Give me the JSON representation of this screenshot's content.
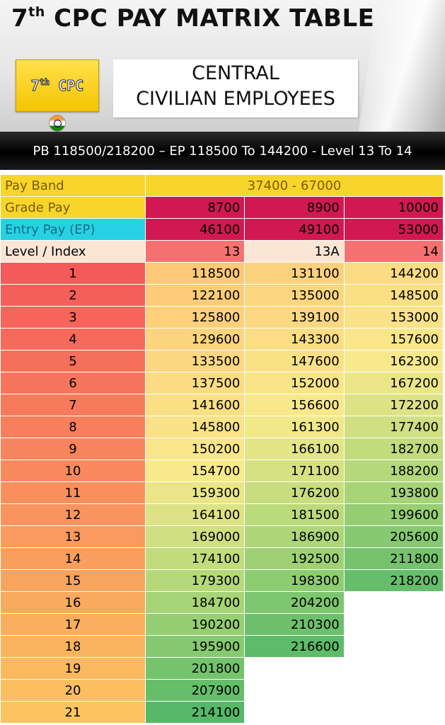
{
  "header": {
    "title_prefix": "7",
    "title_sup": "th",
    "title_main": " CPC PAY MATRIX TABLE",
    "badge_num": "7",
    "badge_sup": "th",
    "badge_word": " CPC",
    "subtitle_line1": "CENTRAL",
    "subtitle_line2": "CIVILIAN EMPLOYEES"
  },
  "range_text": "PB 118500/218200 – EP 118500 To 144200 - Level 13 To 14",
  "colors": {
    "gold": "#f8d52b",
    "crimson": "#d21852",
    "cyan": "#27d1e3",
    "cream": "#fbe6d6",
    "salmon": "#f57272"
  },
  "matrix": {
    "pay_band_label": "Pay Band",
    "pay_band_value": "37400 - 67000",
    "grade_pay_label": "Grade Pay",
    "grade_pay": [
      "8700",
      "8900",
      "10000"
    ],
    "entry_pay_label": "Entry Pay (EP)",
    "entry_pay": [
      "46100",
      "49100",
      "53000"
    ],
    "level_label": "Level / Index",
    "levels": [
      "13",
      "13A",
      "14"
    ],
    "rows": [
      {
        "index": "1",
        "values": [
          "118500",
          "131100",
          "144200"
        ]
      },
      {
        "index": "2",
        "values": [
          "122100",
          "135000",
          "148500"
        ]
      },
      {
        "index": "3",
        "values": [
          "125800",
          "139100",
          "153000"
        ]
      },
      {
        "index": "4",
        "values": [
          "129600",
          "143300",
          "157600"
        ]
      },
      {
        "index": "5",
        "values": [
          "133500",
          "147600",
          "162300"
        ]
      },
      {
        "index": "6",
        "values": [
          "137500",
          "152000",
          "167200"
        ]
      },
      {
        "index": "7",
        "values": [
          "141600",
          "156600",
          "172200"
        ]
      },
      {
        "index": "8",
        "values": [
          "145800",
          "161300",
          "177400"
        ]
      },
      {
        "index": "9",
        "values": [
          "150200",
          "166100",
          "182700"
        ]
      },
      {
        "index": "10",
        "values": [
          "154700",
          "171100",
          "188200"
        ]
      },
      {
        "index": "11",
        "values": [
          "159300",
          "176200",
          "193800"
        ]
      },
      {
        "index": "12",
        "values": [
          "164100",
          "181500",
          "199600"
        ]
      },
      {
        "index": "13",
        "values": [
          "169000",
          "186900",
          "205600"
        ]
      },
      {
        "index": "14",
        "values": [
          "174100",
          "192500",
          "211800"
        ]
      },
      {
        "index": "15",
        "values": [
          "179300",
          "198300",
          "218200"
        ]
      },
      {
        "index": "16",
        "values": [
          "184700",
          "204200",
          ""
        ]
      },
      {
        "index": "17",
        "values": [
          "190200",
          "210300",
          ""
        ]
      },
      {
        "index": "18",
        "values": [
          "195900",
          "216600",
          ""
        ]
      },
      {
        "index": "19",
        "values": [
          "201800",
          "",
          ""
        ]
      },
      {
        "index": "20",
        "values": [
          "207900",
          "",
          ""
        ]
      },
      {
        "index": "21",
        "values": [
          "214100",
          "",
          ""
        ]
      }
    ]
  }
}
